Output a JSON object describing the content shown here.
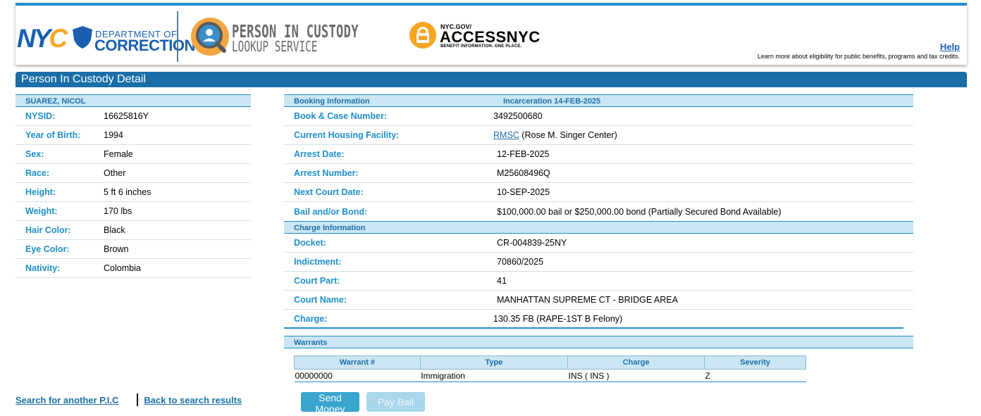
{
  "header": {
    "nyc_logo": "NYC",
    "dept_line1": "DEPARTMENT OF",
    "dept_line2": "CORRECTION",
    "service_line1": "PERSON IN CUSTODY",
    "service_line2": "LOOKUP SERVICE",
    "access_line1": "NYC.GOV/",
    "access_line2": "ACCESSNYC",
    "access_line3": "BENEFIT INFORMATION. ONE PLACE.",
    "help_label": "Help",
    "help_text": "Learn more about eligibility for public benefits, programs and tax credits.",
    "brand_blue": "#1a5fb0",
    "brand_orange": "#f5a623"
  },
  "page_title": "Person In Custody Detail",
  "person": {
    "name": "SUAREZ, NICOL",
    "fields": [
      {
        "label": "NYSID:",
        "value": "16625816Y"
      },
      {
        "label": "Year of Birth:",
        "value": "1994"
      },
      {
        "label": "Sex:",
        "value": "Female"
      },
      {
        "label": "Race:",
        "value": "Other"
      },
      {
        "label": "Height:",
        "value": "5 ft 6 inches"
      },
      {
        "label": "Weight:",
        "value": "170 lbs"
      },
      {
        "label": "Hair Color:",
        "value": "Black"
      },
      {
        "label": "Eye Color:",
        "value": "Brown"
      },
      {
        "label": "Nativity:",
        "value": "Colombia"
      }
    ]
  },
  "booking": {
    "heading": "Booking Information",
    "incarceration": "Incarceration 14-FEB-2025",
    "book_case_label": "Book & Case Number:",
    "book_case_value": "3492500680",
    "housing_label": "Current Housing Facility:",
    "housing_link": "RMSC",
    "housing_name": "(Rose M. Singer Center)",
    "arrest_date_label": "Arrest Date:",
    "arrest_date_value": "12-FEB-2025",
    "arrest_number_label": "Arrest Number:",
    "arrest_number_value": "M25608496Q",
    "next_court_label": "Next Court Date:",
    "next_court_value": "10-SEP-2025",
    "bail_label": "Bail and/or Bond:",
    "bail_value": "$100,000.00 bail or $250,000.00 bond (Partially Secured Bond Available)"
  },
  "charge": {
    "heading": "Charge Information",
    "docket_label": "Docket:",
    "docket_value": "CR-004839-25NY",
    "indictment_label": "Indictment:",
    "indictment_value": "70860/2025",
    "court_part_label": "Court Part:",
    "court_part_value": "41",
    "court_name_label": "Court Name:",
    "court_name_value": "MANHATTAN SUPREME CT - BRIDGE AREA",
    "charge_label": "Charge:",
    "charge_value": "130.35 FB (RAPE-1ST B Felony)"
  },
  "warrants": {
    "heading": "Warrants",
    "columns": [
      "Warrant #",
      "Type",
      "Charge",
      "Severity"
    ],
    "rows": [
      [
        "00000000",
        "Immigration",
        "INS ( INS )",
        "Z"
      ]
    ]
  },
  "buttons": {
    "send_money": "Send Money",
    "pay_bail": "Pay Bail"
  },
  "links": {
    "search_another": "Search for another P.I.C",
    "back_results": "Back to search results"
  }
}
